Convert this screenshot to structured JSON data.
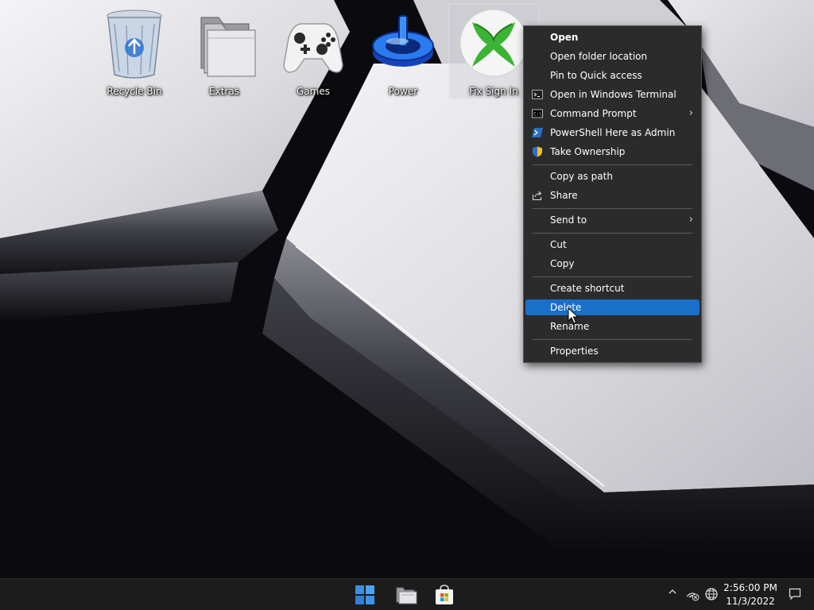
{
  "desktop": {
    "icons": [
      {
        "label": "Recycle Bin",
        "icon": "recycle-bin-icon"
      },
      {
        "label": "Extras",
        "icon": "folder-icon"
      },
      {
        "label": "Games",
        "icon": "xbox-controller-icon"
      },
      {
        "label": "Power",
        "icon": "power-icon"
      },
      {
        "label": "Fix Sign In",
        "icon": "xbox-logo-icon",
        "selected": true
      }
    ]
  },
  "context_menu": {
    "items": [
      {
        "label": "Open",
        "bold": true
      },
      {
        "label": "Open folder location"
      },
      {
        "label": "Pin to Quick access"
      },
      {
        "label": "Open in Windows Terminal",
        "icon": "terminal-icon"
      },
      {
        "label": "Command Prompt",
        "icon": "command-prompt-icon",
        "submenu": true
      },
      {
        "label": "PowerShell Here as Admin",
        "icon": "powershell-icon"
      },
      {
        "label": "Take Ownership",
        "icon": "uac-shield-icon"
      },
      {
        "label": "Copy as path"
      },
      {
        "label": "Share",
        "icon": "share-icon"
      },
      {
        "label": "Send to",
        "submenu": true
      },
      {
        "label": "Cut"
      },
      {
        "label": "Copy"
      },
      {
        "label": "Create shortcut"
      },
      {
        "label": "Delete",
        "highlighted": true
      },
      {
        "label": "Rename"
      },
      {
        "label": "Properties"
      }
    ],
    "submenu_arrow": "›"
  },
  "taskbar": {
    "buttons": [
      {
        "name": "start-button",
        "icon": "windows-logo-icon"
      },
      {
        "name": "file-explorer-button",
        "icon": "file-explorer-icon"
      },
      {
        "name": "microsoft-store-button",
        "icon": "store-icon"
      }
    ],
    "tray": {
      "chevron": "^",
      "icons": [
        "network-disconnected-icon",
        "globe-icon"
      ]
    },
    "clock": {
      "time": "2:56:00 PM",
      "date": "11/3/2022"
    }
  },
  "colors": {
    "menu_bg": "#2b2b2b",
    "menu_highlight": "#1a6fc9",
    "taskbar_bg": "#1c1c1c",
    "start_blue": "#3b8fe0"
  }
}
